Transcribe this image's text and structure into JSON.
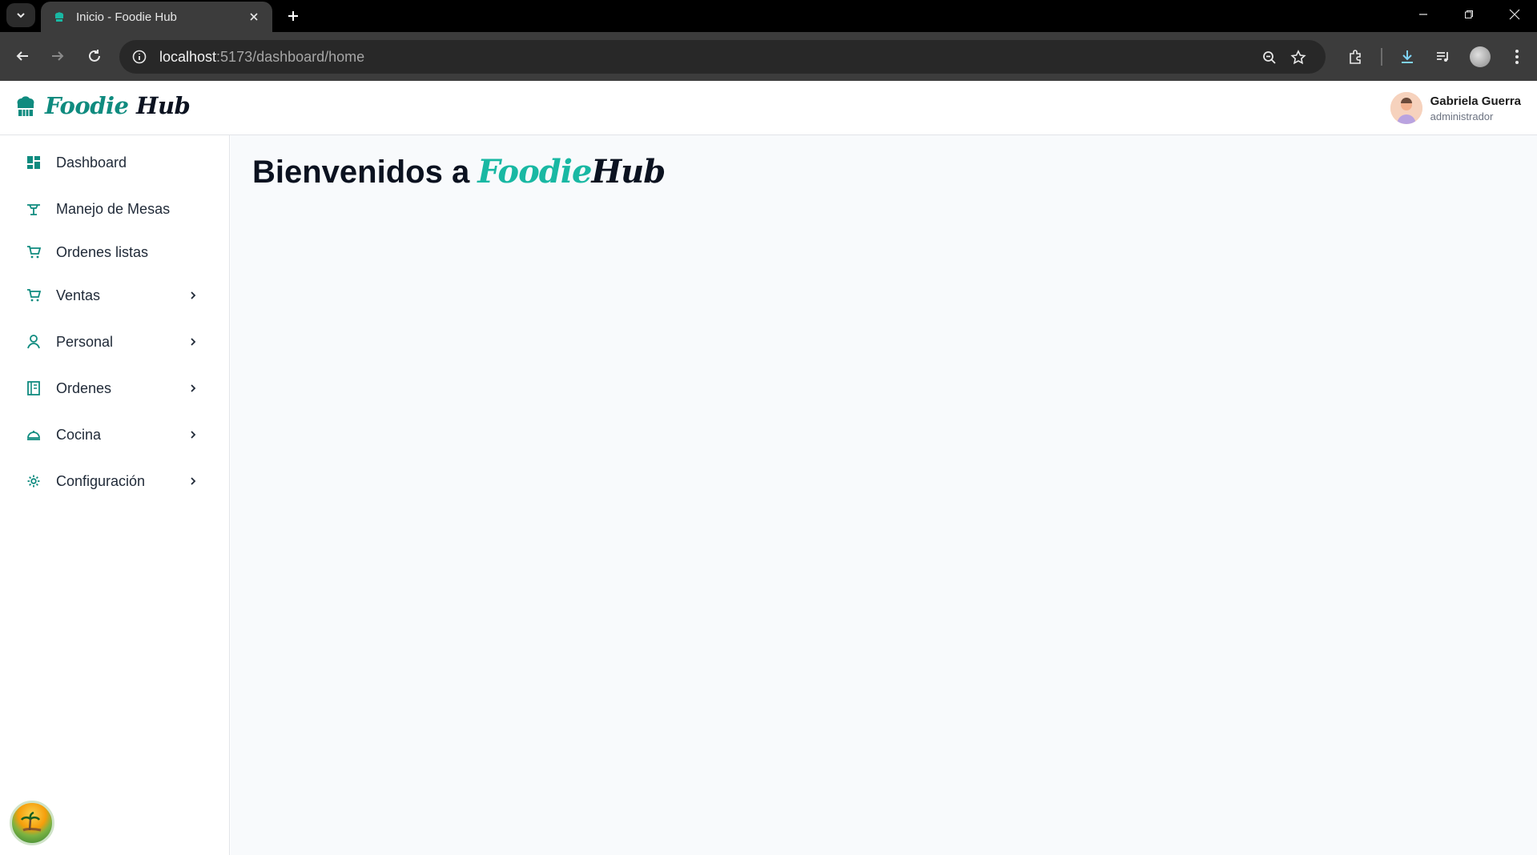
{
  "browser": {
    "tab_title": "Inicio - Foodie Hub",
    "url_host": "localhost",
    "url_path": ":5173/dashboard/home"
  },
  "header": {
    "brand_foodie": "Foodie",
    "brand_hub": "Hub",
    "user_name": "Gabriela Guerra",
    "user_role": "administrador"
  },
  "sidebar": {
    "items": [
      {
        "label": "Dashboard",
        "icon": "dashboard-icon",
        "has_submenu": false
      },
      {
        "label": "Manejo de Mesas",
        "icon": "table-icon",
        "has_submenu": false
      },
      {
        "label": "Ordenes listas",
        "icon": "cart-icon",
        "has_submenu": false
      },
      {
        "label": "Ventas",
        "icon": "cart-icon",
        "has_submenu": true
      },
      {
        "label": "Personal",
        "icon": "user-icon",
        "has_submenu": true
      },
      {
        "label": "Ordenes",
        "icon": "notebook-icon",
        "has_submenu": true
      },
      {
        "label": "Cocina",
        "icon": "cloche-icon",
        "has_submenu": true
      },
      {
        "label": "Configuración",
        "icon": "gear-icon",
        "has_submenu": true
      }
    ]
  },
  "main": {
    "welcome_prefix": "Bienvenidos a",
    "welcome_foodie": "Foodie",
    "welcome_hub": "Hub"
  },
  "colors": {
    "accent": "#0f8b7f",
    "accent_light": "#19b8a3",
    "chrome_dark": "#3c3c3c"
  }
}
